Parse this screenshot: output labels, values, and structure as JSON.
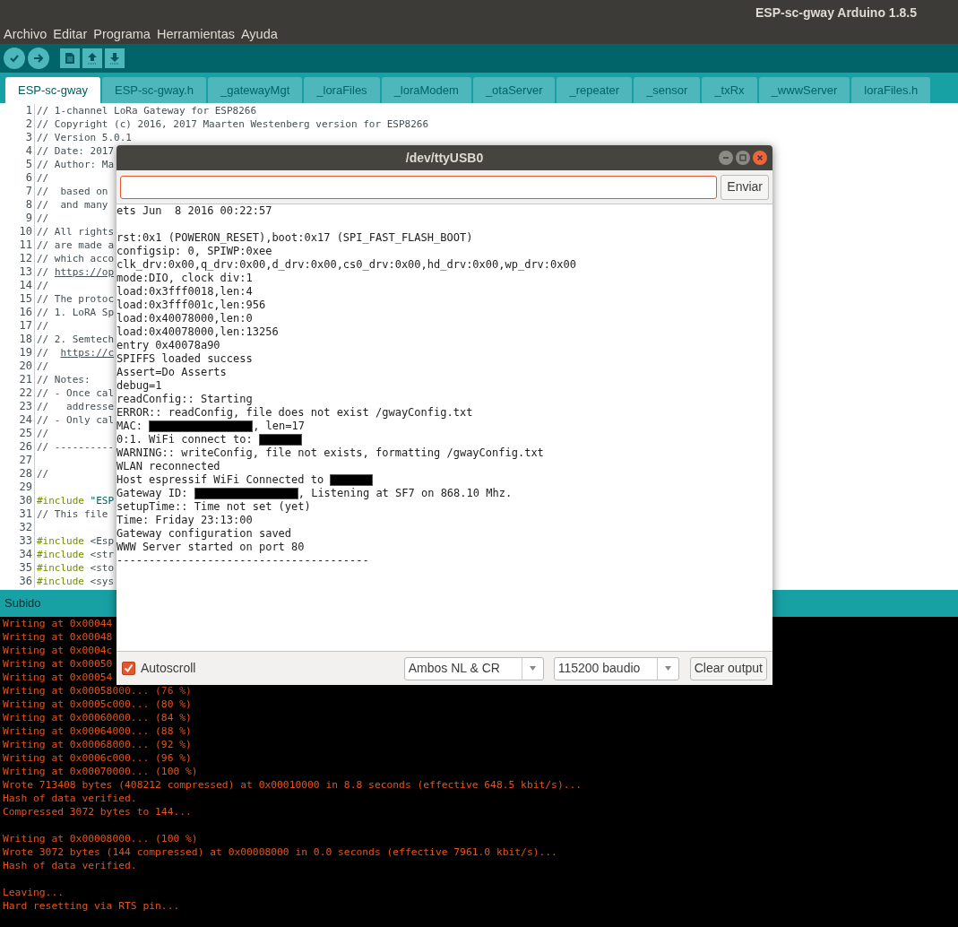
{
  "window": {
    "title": "ESP-sc-gway Arduino 1.8.5"
  },
  "menu": [
    "Archivo",
    "Editar",
    "Programa",
    "Herramientas",
    "Ayuda"
  ],
  "toolbar": [
    {
      "kind": "verify"
    },
    {
      "kind": "upload"
    },
    {
      "kind": "new"
    },
    {
      "kind": "open"
    },
    {
      "kind": "save"
    }
  ],
  "tabs": [
    {
      "label": "ESP-sc-gway",
      "selected": true
    },
    {
      "label": "ESP-sc-gway.h",
      "selected": false
    },
    {
      "label": "_gatewayMgt",
      "selected": false
    },
    {
      "label": "_loraFiles",
      "selected": false
    },
    {
      "label": "_loraModem",
      "selected": false
    },
    {
      "label": "_otaServer",
      "selected": false
    },
    {
      "label": "_repeater",
      "selected": false
    },
    {
      "label": "_sensor",
      "selected": false
    },
    {
      "label": "_txRx",
      "selected": false
    },
    {
      "label": "_wwwServer",
      "selected": false
    },
    {
      "label": "loraFiles.h",
      "selected": false
    }
  ],
  "editor": {
    "lines": [
      {
        "number": "1",
        "parts": [
          {
            "kind": "comment",
            "text": "// 1-channel LoRa Gateway for ESP8266"
          }
        ]
      },
      {
        "number": "2",
        "parts": [
          {
            "kind": "comment",
            "text": "// Copyright (c) 2016, 2017 Maarten Westenberg version for ESP8266"
          }
        ]
      },
      {
        "number": "3",
        "parts": [
          {
            "kind": "comment",
            "text": "// Version 5.0.1"
          }
        ]
      },
      {
        "number": "4",
        "parts": [
          {
            "kind": "comment",
            "text": "// Date: 2017"
          }
        ]
      },
      {
        "number": "5",
        "parts": [
          {
            "kind": "comment",
            "text": "// Author: Ma"
          }
        ]
      },
      {
        "number": "6",
        "parts": [
          {
            "kind": "comment",
            "text": "//"
          }
        ]
      },
      {
        "number": "7",
        "parts": [
          {
            "kind": "comment",
            "text": "//  based on"
          }
        ]
      },
      {
        "number": "8",
        "parts": [
          {
            "kind": "comment",
            "text": "//  and many"
          }
        ]
      },
      {
        "number": "9",
        "parts": [
          {
            "kind": "comment",
            "text": "//"
          }
        ]
      },
      {
        "number": "10",
        "parts": [
          {
            "kind": "comment",
            "text": "// All rights"
          }
        ]
      },
      {
        "number": "11",
        "parts": [
          {
            "kind": "comment",
            "text": "// are made a"
          }
        ]
      },
      {
        "number": "12",
        "parts": [
          {
            "kind": "comment",
            "text": "// which acco"
          }
        ]
      },
      {
        "number": "13",
        "parts": [
          {
            "kind": "comment",
            "text": "// "
          },
          {
            "kind": "link",
            "text": "https://op"
          }
        ]
      },
      {
        "number": "14",
        "parts": [
          {
            "kind": "comment",
            "text": "//"
          }
        ]
      },
      {
        "number": "15",
        "parts": [
          {
            "kind": "comment",
            "text": "// The protoc"
          }
        ]
      },
      {
        "number": "16",
        "parts": [
          {
            "kind": "comment",
            "text": "// 1. LoRA Sp"
          }
        ]
      },
      {
        "number": "17",
        "parts": [
          {
            "kind": "comment",
            "text": "//"
          }
        ]
      },
      {
        "number": "18",
        "parts": [
          {
            "kind": "comment",
            "text": "// 2. Semtech"
          }
        ]
      },
      {
        "number": "19",
        "parts": [
          {
            "kind": "comment",
            "text": "//  "
          },
          {
            "kind": "link",
            "text": "https://c"
          }
        ]
      },
      {
        "number": "20",
        "parts": [
          {
            "kind": "comment",
            "text": "//"
          }
        ]
      },
      {
        "number": "21",
        "parts": [
          {
            "kind": "comment",
            "text": "// Notes:"
          }
        ]
      },
      {
        "number": "22",
        "parts": [
          {
            "kind": "comment",
            "text": "// - Once cal"
          }
        ]
      },
      {
        "number": "23",
        "parts": [
          {
            "kind": "comment",
            "text": "//   addresse"
          }
        ]
      },
      {
        "number": "24",
        "parts": [
          {
            "kind": "comment",
            "text": "// - Only cal"
          }
        ]
      },
      {
        "number": "25",
        "parts": [
          {
            "kind": "comment",
            "text": "//"
          }
        ]
      },
      {
        "number": "26",
        "parts": [
          {
            "kind": "comment",
            "text": "// ----------"
          }
        ]
      },
      {
        "number": "27"
      },
      {
        "number": "28",
        "parts": [
          {
            "kind": "comment",
            "text": "//"
          }
        ]
      },
      {
        "number": "29"
      },
      {
        "number": "30",
        "parts": [
          {
            "kind": "preproc",
            "text": "#include"
          },
          {
            "kind": "string",
            "text": " \"ESP"
          }
        ]
      },
      {
        "number": "31",
        "parts": [
          {
            "kind": "comment",
            "text": "// This file"
          }
        ]
      },
      {
        "number": "32"
      },
      {
        "number": "33",
        "parts": [
          {
            "kind": "preproc",
            "text": "#include"
          },
          {
            "kind": "plain",
            "text": " <Esp"
          }
        ]
      },
      {
        "number": "34",
        "parts": [
          {
            "kind": "preproc",
            "text": "#include"
          },
          {
            "kind": "plain",
            "text": " <str"
          }
        ]
      },
      {
        "number": "35",
        "parts": [
          {
            "kind": "preproc",
            "text": "#include"
          },
          {
            "kind": "plain",
            "text": " <sto"
          }
        ]
      },
      {
        "number": "36",
        "parts": [
          {
            "kind": "preproc",
            "text": "#include"
          },
          {
            "kind": "plain",
            "text": " <sys"
          }
        ]
      }
    ]
  },
  "status": {
    "label": "Subido"
  },
  "console": {
    "lines": [
      "Writing at 0x00044",
      "Writing at 0x00048",
      "Writing at 0x0004c",
      "Writing at 0x00050",
      "Writing at 0x00054",
      "Writing at 0x00058000... (76 %)",
      "Writing at 0x0005c000... (80 %)",
      "Writing at 0x00060000... (84 %)",
      "Writing at 0x00064000... (88 %)",
      "Writing at 0x00068000... (92 %)",
      "Writing at 0x0006c000... (96 %)",
      "Writing at 0x00070000... (100 %)",
      "Wrote 713408 bytes (408212 compressed) at 0x00010000 in 8.8 seconds (effective 648.5 kbit/s)...",
      "Hash of data verified.",
      "Compressed 3072 bytes to 144...",
      {
        "kind": "blank"
      },
      "Writing at 0x00008000... (100 %)",
      "Wrote 3072 bytes (144 compressed) at 0x00008000 in 0.0 seconds (effective 7961.0 kbit/s)...",
      "Hash of data verified.",
      {
        "kind": "blank"
      },
      "Leaving...",
      "Hard resetting via RTS pin..."
    ]
  },
  "serial_monitor": {
    "title": "/dev/ttyUSB0",
    "send_button": "Enviar",
    "output": [
      [
        {
          "kind": "text",
          "text": "ets Jun  8 2016 00:22:57"
        }
      ],
      {
        "kind": "blank"
      },
      [
        {
          "kind": "text",
          "text": "rst:0x1 (POWERON_RESET),boot:0x17 (SPI_FAST_FLASH_BOOT)"
        }
      ],
      [
        {
          "kind": "text",
          "text": "configsip: 0, SPIWP:0xee"
        }
      ],
      [
        {
          "kind": "text",
          "text": "clk_drv:0x00,q_drv:0x00,d_drv:0x00,cs0_drv:0x00,hd_drv:0x00,wp_drv:0x00"
        }
      ],
      [
        {
          "kind": "text",
          "text": "mode:DIO, clock div:1"
        }
      ],
      [
        {
          "kind": "text",
          "text": "load:0x3fff0018,len:4"
        }
      ],
      [
        {
          "kind": "text",
          "text": "load:0x3fff001c,len:956"
        }
      ],
      [
        {
          "kind": "text",
          "text": "load:0x40078000,len:0"
        }
      ],
      [
        {
          "kind": "text",
          "text": "load:0x40078000,len:13256"
        }
      ],
      [
        {
          "kind": "text",
          "text": "entry 0x40078a90"
        }
      ],
      [
        {
          "kind": "text",
          "text": "SPIFFS loaded success"
        }
      ],
      [
        {
          "kind": "text",
          "text": "Assert=Do Asserts"
        }
      ],
      [
        {
          "kind": "text",
          "text": "debug=1"
        }
      ],
      [
        {
          "kind": "text",
          "text": "readConfig:: Starting"
        }
      ],
      [
        {
          "kind": "text",
          "text": "ERROR:: readConfig, file does not exist /gwayConfig.txt"
        }
      ],
      [
        {
          "kind": "text",
          "text": "MAC: "
        },
        {
          "kind": "redacted"
        },
        {
          "kind": "text",
          "text": ", len=17"
        }
      ],
      [
        {
          "kind": "text",
          "text": "0:1. WiFi connect to: "
        },
        {
          "kind": "redacted"
        }
      ],
      [
        {
          "kind": "text",
          "text": "WARNING:: writeConfig, file not exists, formatting /gwayConfig.txt"
        }
      ],
      [
        {
          "kind": "text",
          "text": "WLAN reconnected"
        }
      ],
      [
        {
          "kind": "text",
          "text": "Host espressif WiFi Connected to "
        },
        {
          "kind": "redacted"
        }
      ],
      [
        {
          "kind": "text",
          "text": "Gateway ID: "
        },
        {
          "kind": "redacted"
        },
        {
          "kind": "text",
          "text": ", Listening at SF7 on 868.10 Mhz."
        }
      ],
      [
        {
          "kind": "text",
          "text": "setupTime:: Time not set (yet)"
        }
      ],
      [
        {
          "kind": "text",
          "text": "Time: Friday 23:13:00"
        }
      ],
      [
        {
          "kind": "text",
          "text": "Gateway configuration saved"
        }
      ],
      [
        {
          "kind": "text",
          "text": "WWW Server started on port 80"
        }
      ],
      [
        {
          "kind": "text",
          "text": "---------------------------------------"
        }
      ]
    ],
    "autoscroll": {
      "label": "Autoscroll",
      "checked": true
    },
    "line_ending": {
      "value": "Ambos NL & CR"
    },
    "baud_rate": {
      "value": "115200 baudio"
    },
    "clear_button": "Clear output"
  }
}
